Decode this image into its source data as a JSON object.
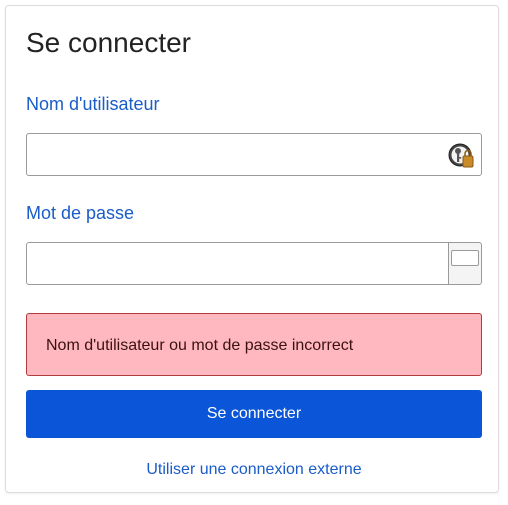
{
  "login": {
    "title": "Se connecter",
    "username": {
      "label": "Nom d'utilisateur",
      "value": "",
      "placeholder": ""
    },
    "password": {
      "label": "Mot de passe",
      "value": "",
      "placeholder": ""
    },
    "error_message": "Nom d'utilisateur ou mot de passe incorrect",
    "submit_label": "Se connecter",
    "external_link": "Utiliser une connexion externe"
  },
  "colors": {
    "accent": "#0a55d8",
    "link": "#1a5cc8",
    "error_bg": "#ffb8bf",
    "error_border": "#b23b3b"
  },
  "icons": {
    "username_field": "password-manager-key-icon",
    "password_toggle": "show-password-toggle"
  }
}
